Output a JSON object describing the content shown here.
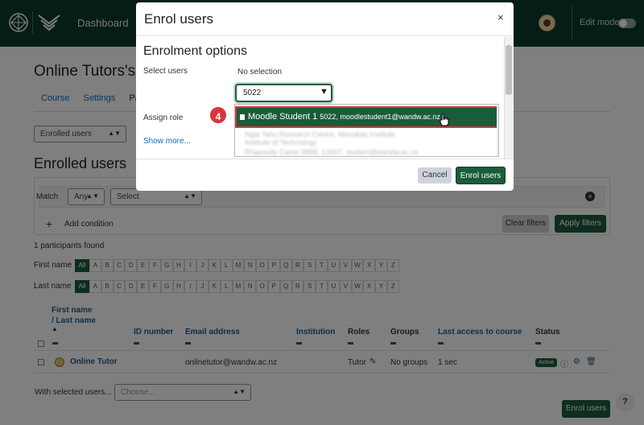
{
  "navbar": {
    "dashboard": "Dashboard",
    "edit_mode": "Edit mode"
  },
  "page": {
    "title": "Online Tutors's",
    "tabs": [
      "Course",
      "Settings",
      "Par"
    ],
    "enrolled_select": "Enrolled users",
    "heading": "Enrolled users",
    "filter": {
      "match_label": "Match",
      "match_value": "Any",
      "select_value": "Select",
      "add_condition": "Add condition",
      "clear": "Clear filters",
      "apply": "Apply filters"
    },
    "found": "1 participants found",
    "first_name_label": "First name",
    "last_name_label": "Last name",
    "initials": [
      "All",
      "A",
      "B",
      "C",
      "D",
      "E",
      "F",
      "G",
      "H",
      "I",
      "J",
      "K",
      "L",
      "M",
      "N",
      "O",
      "P",
      "Q",
      "R",
      "S",
      "T",
      "U",
      "V",
      "W",
      "X",
      "Y",
      "Z"
    ],
    "table": {
      "headers": {
        "first_name": "First name",
        "last_name": "/ Last name",
        "id_number": "ID number",
        "email": "Email address",
        "institution": "Institution",
        "roles": "Roles",
        "groups": "Groups",
        "last_access": "Last access to course",
        "status": "Status"
      },
      "rows": [
        {
          "name": "Online Tutor",
          "email": "onlinetutor@wandw.ac.nz",
          "role": "Tutor",
          "groups": "No groups",
          "last_access": "1 sec",
          "status": "Active"
        }
      ]
    },
    "with_selected": "With selected users...",
    "choose": "Choose...",
    "enrol_users": "Enrol users",
    "help": "?"
  },
  "modal": {
    "title": "Enrol users",
    "close": "×",
    "section": "Enrolment options",
    "select_users_label": "Select users",
    "no_selection": "No selection",
    "search_value": "5022",
    "assign_role_label": "Assign role",
    "show_more": "Show more...",
    "dropdown": {
      "selected_name": "Moodle Student 1",
      "selected_detail": "5022, moodlestudent1@wandw.ac.nz",
      "blurred_1": "Ngai Tahu Research Centre, Manukau Institute",
      "blurred_2": "Institute of Technology",
      "blurred_3": "Rhapsody Carter 8888, 13007, student@wandw.ac.nz"
    },
    "step": "4",
    "cancel": "Cancel",
    "enrol": "Enrol users"
  },
  "colors": {
    "brand": "#0d3b2e",
    "primary_button": "#1a5c3a",
    "highlight": "#d9363e"
  }
}
